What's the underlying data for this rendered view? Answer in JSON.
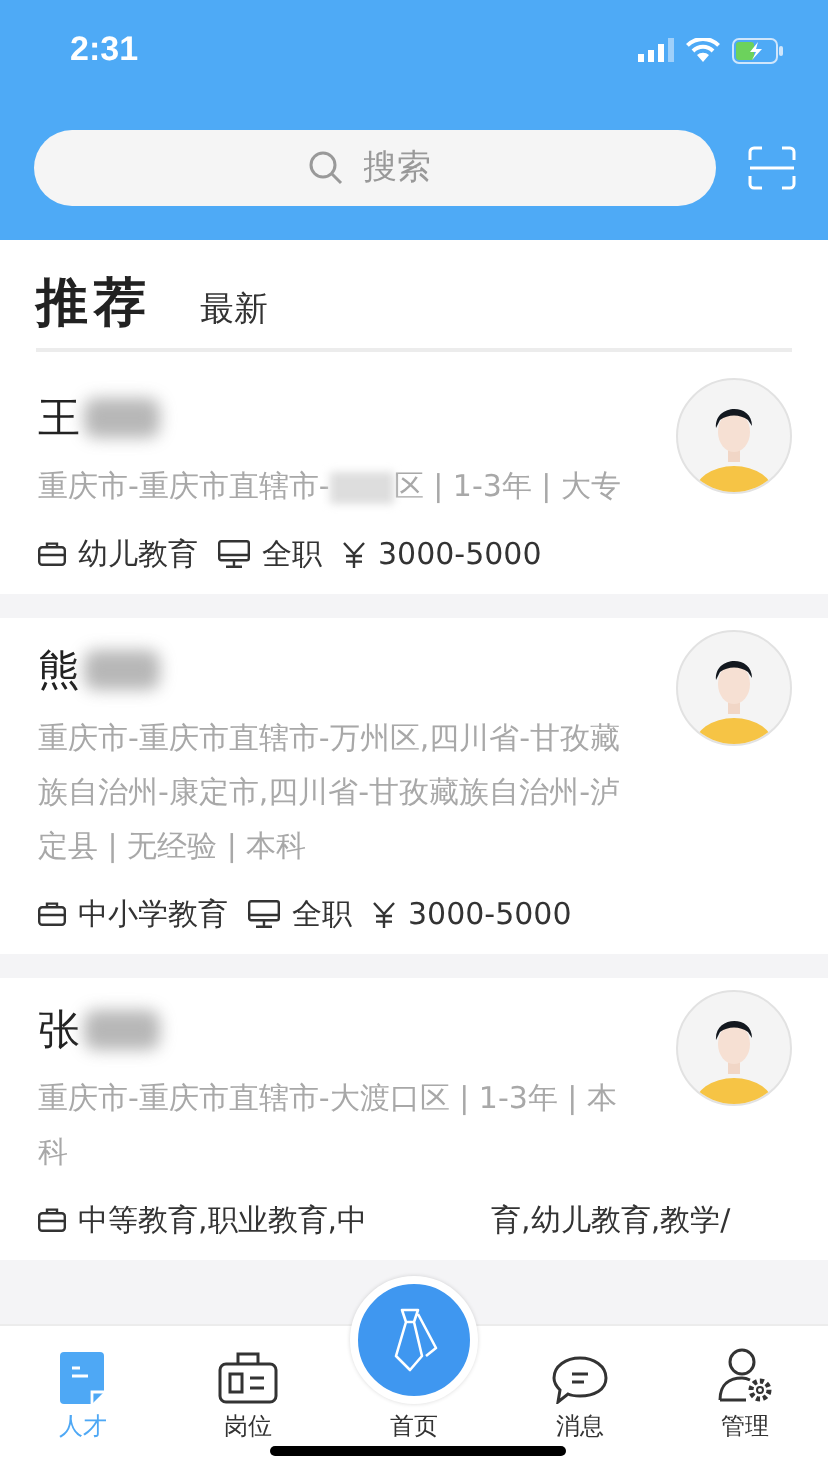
{
  "status_bar": {
    "time": "2:31"
  },
  "search": {
    "placeholder": "搜索"
  },
  "tabs": [
    {
      "label": "推荐",
      "selected": true
    },
    {
      "label": "最新",
      "selected": false
    }
  ],
  "candidates": [
    {
      "surname": "王",
      "info": "重庆市-重庆市直辖市-",
      "info_after_blur": "区 | 1-3年 | 大专",
      "tags": [
        {
          "kind": "field",
          "text": "幼儿教育"
        },
        {
          "kind": "job",
          "text": "全职"
        },
        {
          "kind": "salary",
          "text": "3000-5000"
        }
      ]
    },
    {
      "surname": "熊",
      "info": "重庆市-重庆市直辖市-万州区,四川省-甘孜藏族自治州-康定市,四川省-甘孜藏族自治州-泸定县 | 无经验 | 本科",
      "tags": [
        {
          "kind": "field",
          "text": "中小学教育"
        },
        {
          "kind": "job",
          "text": "全职"
        },
        {
          "kind": "salary",
          "text": "3000-5000"
        }
      ]
    },
    {
      "surname": "张",
      "info": "重庆市-重庆市直辖市-大渡口区 | 1-3年 | 本科",
      "tags": [
        {
          "kind": "field_cut",
          "parts": [
            "中等教育,职业教育,中",
            "育,幼儿教育,教学/"
          ]
        }
      ]
    }
  ],
  "nav": [
    {
      "label": "人才",
      "kind": "talent",
      "selected": true
    },
    {
      "label": "岗位",
      "kind": "jobs",
      "selected": false
    },
    {
      "label": "首页",
      "kind": "home",
      "selected": false
    },
    {
      "label": "消息",
      "kind": "messages",
      "selected": false
    },
    {
      "label": "管理",
      "kind": "manage",
      "selected": false
    }
  ]
}
